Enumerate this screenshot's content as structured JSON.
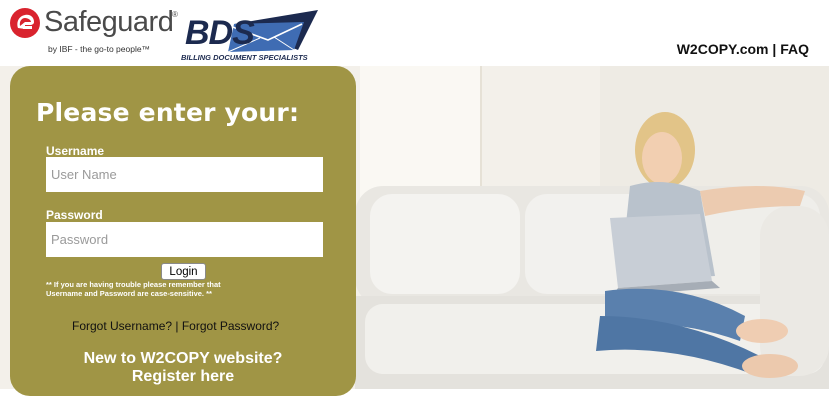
{
  "header": {
    "safeguard_word": "Safeguard",
    "safeguard_tm": "®",
    "safeguard_tagline": "by IBF - the go-to people™",
    "bds_letters": "BDS",
    "bds_subtitle": "BILLING DOCUMENT SPECIALISTS",
    "link_w2copy": "W2COPY.com",
    "link_separator": " | ",
    "link_faq": "FAQ"
  },
  "login": {
    "title": "Please enter your:",
    "username_label": "Username",
    "username_placeholder": "User Name",
    "password_label": "Password",
    "password_placeholder": "Password",
    "login_button": "Login",
    "note_line1": "** If you are having trouble please remember that",
    "note_line2": "Username and Password are case-sensitive. **",
    "forgot_username": "Forgot Username?",
    "forgot_separator": " | ",
    "forgot_password": "Forgot Password?",
    "new_to_line1": "New to W2COPY website?",
    "new_to_line2": "Register here"
  },
  "colors": {
    "panel": "#a09545",
    "safeguard_red": "#d9232e",
    "bds_navy": "#1c2a4f"
  },
  "icons": {
    "safeguard_logo": "safeguard-helmet-icon",
    "bds_logo": "bds-envelope-icon"
  }
}
